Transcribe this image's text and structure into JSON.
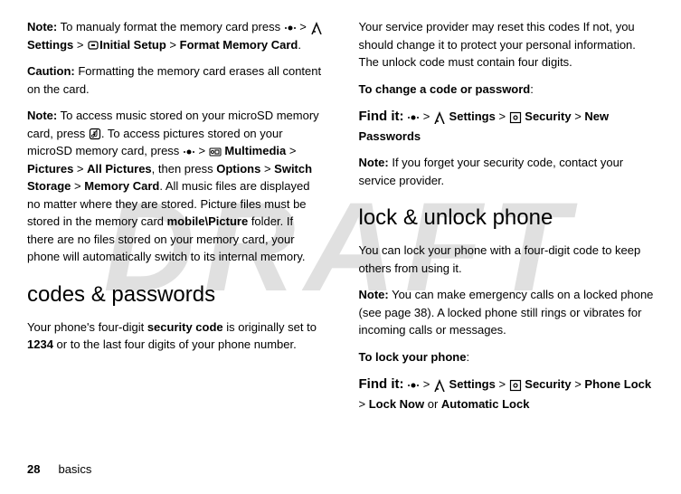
{
  "watermark": "DRAFT",
  "footer": {
    "pageNumber": "28",
    "section": "basics"
  },
  "left": {
    "p1": {
      "noteLabel": "Note:",
      "t1": " To manualy format the memory card press ",
      "gt1": " > ",
      "settings": " Settings",
      "gt2": " > ",
      "initialSetup": "Initial Setup",
      "gt3": " > ",
      "formatMemoryCard": "Format Memory Card",
      "period": "."
    },
    "p2": {
      "cautionLabel": "Caution:",
      "text": " Formatting the memory card erases all content on the card."
    },
    "p3": {
      "noteLabel": "Note:",
      "t1": " To access music stored on your microSD memory card, press ",
      "t2": ". To access pictures stored on your microSD memory card, press ",
      "gt1": " > ",
      "multimedia": " Multimedia",
      "gt2": " > ",
      "pictures": "Pictures",
      "gt3": " > ",
      "allPictures": "All Pictures",
      "t3": ", then press ",
      "options": "Options",
      "gt4": " > ",
      "switchStorage": "Switch Storage",
      "gt5": " > ",
      "memoryCard": "Memory Card",
      "t4": ". All music files are displayed no matter where they are stored. Picture files must be stored in the memory card ",
      "mobilePicture": "mobile\\Picture",
      "t5": " folder. If there are no files stored on your memory card, your phone will automatically switch to its internal memory."
    },
    "h1": "codes & passwords",
    "p4": {
      "t1": "Your phone's four-digit ",
      "securityCode": "security code",
      "t2": " is originally set to ",
      "v1234": "1234",
      "t3": " or to the last four digits of your phone number."
    }
  },
  "right": {
    "p1": "Your service provider may reset this codes If not, you should change it to protect your personal information. The unlock code must contain four digits.",
    "p2Label": "To change a code or password",
    "p2Colon": ":",
    "findIt1": {
      "label": "Find it:",
      "gt1": " > ",
      "settings": " Settings",
      "gt2": " > ",
      "security": " Security",
      "gt3": " > ",
      "newPasswords": "New Passwords"
    },
    "p3": {
      "noteLabel": "Note:",
      "text": " If you forget your security code, contact your service provider."
    },
    "h1": "lock & unlock phone",
    "p4": "You can lock your phone with a four-digit code to keep others from using it.",
    "p5": {
      "noteLabel": "Note:",
      "text": " You can make emergency calls on a locked phone (see page 38). A locked phone still rings or vibrates for incoming calls or messages."
    },
    "p6Label": "To lock your phone",
    "p6Colon": ":",
    "findIt2": {
      "label": "Find it:",
      "gt1": " > ",
      "settings": " Settings",
      "gt2": " > ",
      "security": " Security",
      "gt3": " > ",
      "phoneLock": "Phone Lock",
      "gtLine2": "> ",
      "lockNow": "Lock Now",
      "or": " or ",
      "autoLock": "Automatic Lock"
    }
  }
}
